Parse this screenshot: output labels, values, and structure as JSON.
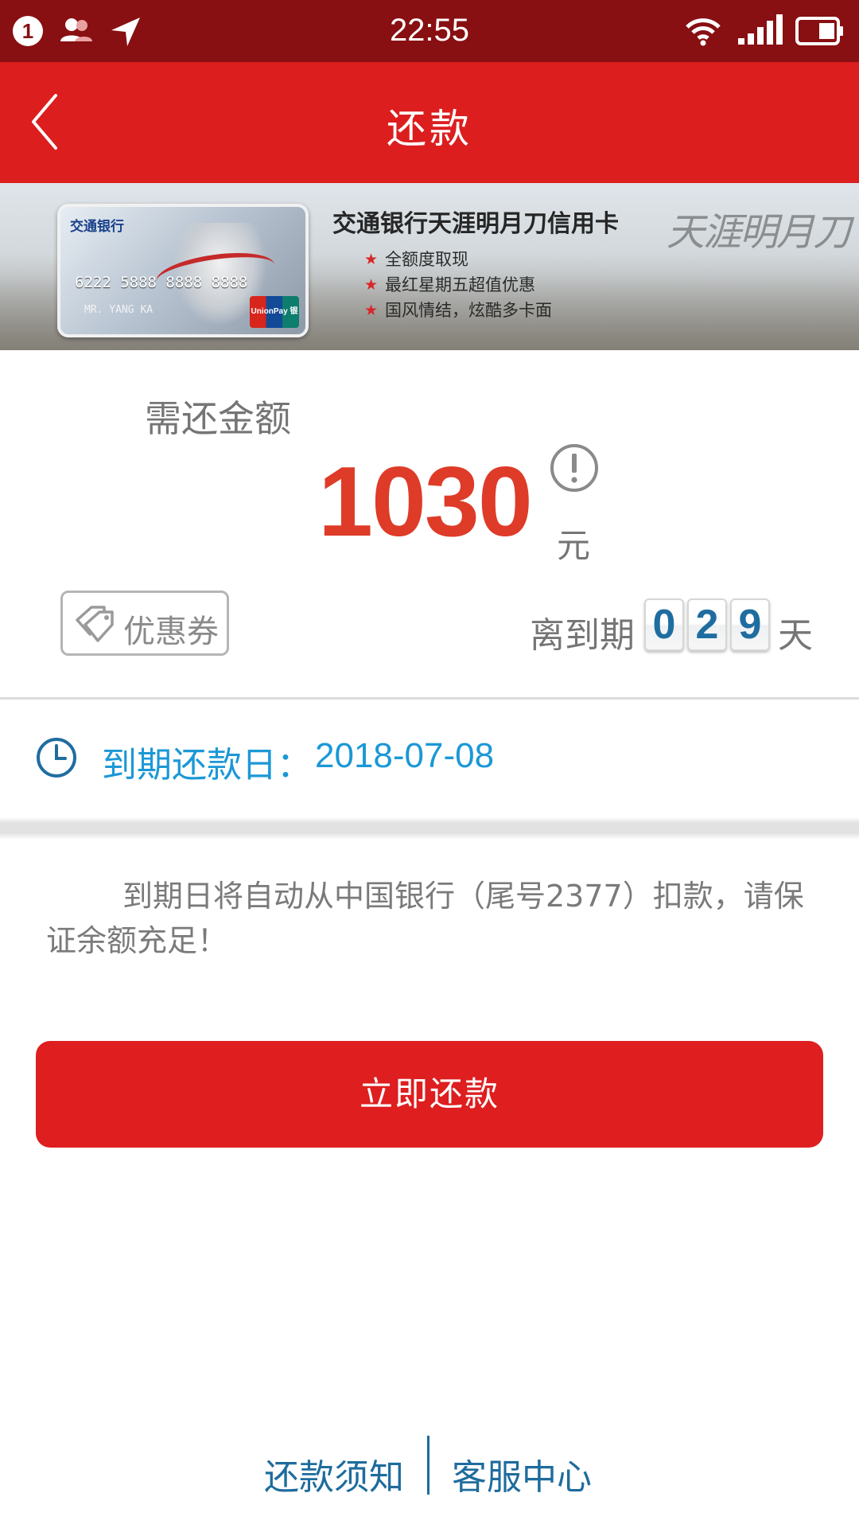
{
  "status_bar": {
    "notification_count": "1",
    "time": "22:55",
    "icons": [
      "contacts-icon",
      "location-arrow-icon",
      "wifi-icon",
      "signal-icon",
      "battery-icon"
    ]
  },
  "header": {
    "title": "还款",
    "back_icon": "chevron-left-icon",
    "background_color": "#dc1e1e"
  },
  "banner": {
    "headline": "交通银行天涯明月刀信用卡",
    "bullets": [
      "全额度取现",
      "最红星期五超值优惠",
      "国风情结，炫酷多卡面"
    ],
    "decorative_title": "天涯明月刀",
    "card": {
      "bank_name": "交通银行",
      "number": "6222 5888 8888 8888",
      "holder": "MR. YANG KA",
      "network": "UnionPay 银联"
    }
  },
  "amount": {
    "label": "需还金额",
    "value": "1030",
    "unit": "元",
    "value_color": "#de3b28"
  },
  "coupon": {
    "label": "优惠券"
  },
  "due_countdown": {
    "prefix": "离到期",
    "digits": [
      "0",
      "2",
      "9"
    ],
    "suffix": "天"
  },
  "due_date": {
    "label": "到期还款日：",
    "value": "2018-07-08",
    "color": "#1b98d6"
  },
  "notice": {
    "text": "到期日将自动从中国银行（尾号2377）扣款，请保证余额充足！"
  },
  "pay_button": {
    "label": "立即还款",
    "color": "#de1e1f"
  },
  "footer": {
    "links": [
      "还款须知",
      "客服中心"
    ],
    "color": "#1e6c9d"
  }
}
